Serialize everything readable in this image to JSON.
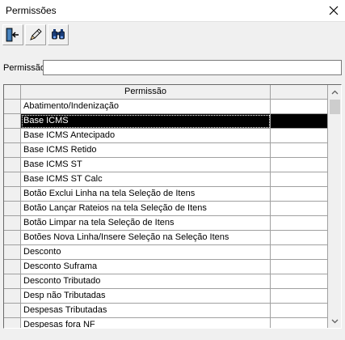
{
  "window": {
    "title": "Permissões"
  },
  "toolbar": {
    "buttons": [
      {
        "icon": "exit-door-icon"
      },
      {
        "icon": "pencil-icon"
      },
      {
        "icon": "binoculars-icon"
      }
    ]
  },
  "filter": {
    "label": "Permissão",
    "value": ""
  },
  "grid": {
    "header": {
      "indicator": "",
      "permission": "Permissão",
      "extra": ""
    },
    "selected_index": 1,
    "rows": [
      "Abatimento/Indenização",
      "Base ICMS",
      "Base ICMS Antecipado",
      "Base ICMS Retido",
      "Base ICMS ST",
      "Base ICMS ST Calc",
      "Botão Exclui Linha na tela Seleção de Itens",
      "Botão Lançar Rateios na tela Seleção de Itens",
      "Botão Limpar na tela Seleção de Itens",
      "Botões Nova Linha/Insere Seleção na Seleção Itens",
      "Desconto",
      "Desconto Suframa",
      "Desconto Tributado",
      "Desp não Tributadas",
      "Despesas Tributadas",
      "Despesas fora NF"
    ]
  }
}
